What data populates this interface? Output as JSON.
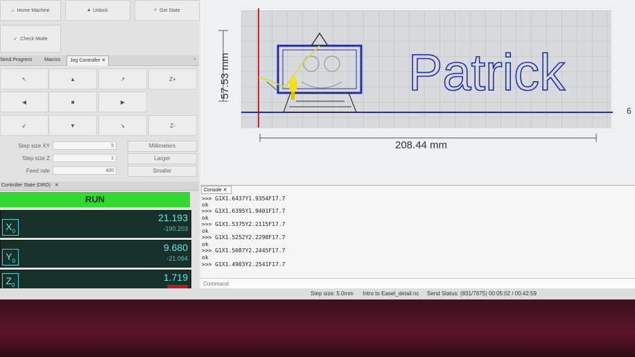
{
  "top_buttons": {
    "home_machine": "Home Machine",
    "unlock": "Unlock",
    "get_state": "Get State",
    "check_mode": "Check Mode"
  },
  "tabs": [
    {
      "label": "Send Progress"
    },
    {
      "label": "Macros"
    },
    {
      "label": "Jog Controller"
    }
  ],
  "jog": {
    "z_plus": "Z+",
    "z_minus": "Z-",
    "step_xy_label": "Step size XY",
    "step_xy_value": "5",
    "step_z_label": "Step size Z",
    "step_z_value": "1",
    "feed_label": "Feed rate",
    "feed_value": "400",
    "units_btn": "Millimeters",
    "larger_btn": "Larger",
    "smaller_btn": "Smaller"
  },
  "dro": {
    "tab_label": "Controller State (DRO)",
    "state": "RUN",
    "axes": [
      {
        "name": "X",
        "sub": "0",
        "work": "21.193",
        "machine": "-190.203"
      },
      {
        "name": "Y",
        "sub": "0",
        "work": "9.680",
        "machine": "-21.094"
      },
      {
        "name": "Z",
        "sub": "0",
        "work": "1.719",
        "machine": ""
      }
    ]
  },
  "preview": {
    "height_dim": "57.53 mm",
    "width_dim": "208.44 mm",
    "text": "Patrick",
    "edge_label": "6"
  },
  "console": {
    "tab_label": "Console",
    "lines": [
      ">>> G1X1.6437Y1.9354F17.7",
      "ok",
      ">>> G1X1.6395Y1.9401F17.7",
      "ok",
      ">>> G1X1.5375Y2.2115F17.7",
      "ok",
      ">>> G1X1.5252Y2.2298F17.7",
      "ok",
      ">>> G1X1.5087Y2.2445F17.7",
      "ok",
      ">>> G1X1.4903Y2.2541F17.7"
    ],
    "command_placeholder": "Command"
  },
  "status": {
    "step_size": "Step size: 5.0mm",
    "file": "Intro to Easel_detail.nc",
    "send_status": "Send Status: (831/7875) 00:05:02 / 00:42:59"
  },
  "colors": {
    "run_green": "#33d833",
    "dro_bg": "#173029",
    "dro_text": "#5ee8e8",
    "toolpath_blue": "#1f2fb0",
    "origin_red": "#d0202a",
    "tool_yellow": "#f0e020"
  }
}
